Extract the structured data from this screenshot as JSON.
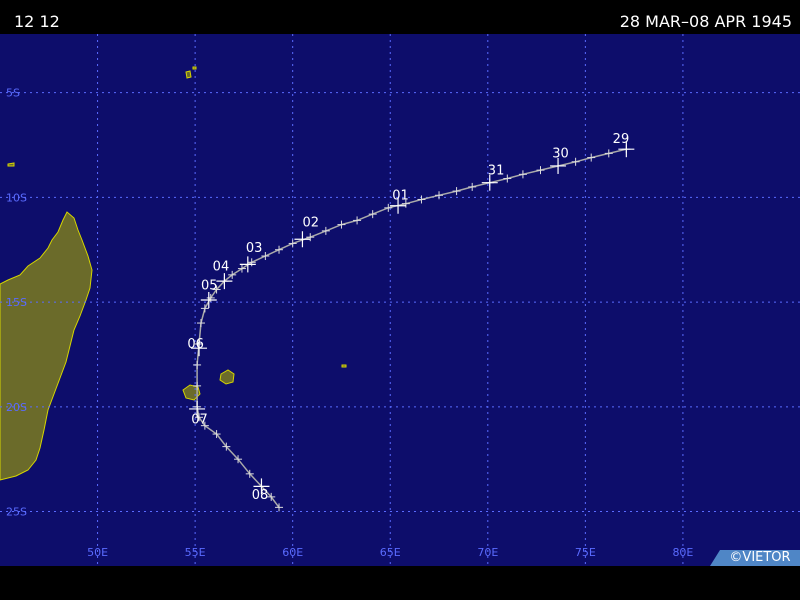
{
  "header": {
    "time_label": "12 12",
    "date_range": "28 MAR–08 APR 1945"
  },
  "credit": "©VIETOR",
  "map": {
    "background": "#0d0d6b",
    "grid_color": "#5a6bff",
    "land_color": "#6b6b2a",
    "coast_color": "#d6d600",
    "track_color": "#aaaaaa",
    "lon_range": [
      45,
      86
    ],
    "lat_range": [
      -27.6,
      -2.2
    ],
    "lon_ticks": [
      50,
      55,
      60,
      65,
      70,
      75,
      80
    ],
    "lon_tick_labels": [
      "50E",
      "55E",
      "60E",
      "65E",
      "70E",
      "75E",
      "80E"
    ],
    "lat_ticks": [
      -5,
      -10,
      -15,
      -20,
      -25
    ],
    "lat_tick_labels": [
      "5S",
      "10S",
      "15S",
      "20S",
      "25S"
    ]
  },
  "track": {
    "points": [
      [
        77.1,
        -7.7
      ],
      [
        76.2,
        -7.9
      ],
      [
        75.3,
        -8.1
      ],
      [
        74.5,
        -8.3
      ],
      [
        73.6,
        -8.5
      ],
      [
        72.7,
        -8.7
      ],
      [
        71.8,
        -8.9
      ],
      [
        71.0,
        -9.1
      ],
      [
        70.1,
        -9.3
      ],
      [
        69.2,
        -9.5
      ],
      [
        68.4,
        -9.7
      ],
      [
        67.5,
        -9.9
      ],
      [
        66.6,
        -10.1
      ],
      [
        65.8,
        -10.3
      ],
      [
        64.9,
        -10.5
      ],
      [
        64.1,
        -10.8
      ],
      [
        63.3,
        -11.1
      ],
      [
        62.5,
        -11.3
      ],
      [
        61.7,
        -11.6
      ],
      [
        60.9,
        -11.9
      ],
      [
        60.0,
        -12.2
      ],
      [
        59.3,
        -12.5
      ],
      [
        58.6,
        -12.8
      ],
      [
        57.9,
        -13.1
      ],
      [
        57.4,
        -13.4
      ],
      [
        56.9,
        -13.7
      ],
      [
        56.5,
        -14.0
      ],
      [
        56.1,
        -14.4
      ],
      [
        55.8,
        -14.8
      ],
      [
        55.5,
        -15.3
      ],
      [
        55.3,
        -16.0
      ],
      [
        55.2,
        -17.0
      ],
      [
        55.1,
        -18.0
      ],
      [
        55.1,
        -19.0
      ],
      [
        55.1,
        -20.0
      ],
      [
        55.2,
        -20.5
      ],
      [
        55.5,
        -20.9
      ],
      [
        56.1,
        -21.3
      ],
      [
        56.6,
        -21.9
      ],
      [
        57.2,
        -22.5
      ],
      [
        57.8,
        -23.2
      ],
      [
        58.4,
        -23.8
      ],
      [
        58.9,
        -24.3
      ],
      [
        59.3,
        -24.8
      ]
    ],
    "daily_labels": [
      {
        "text": "29",
        "lon": 76.4,
        "lat": -7.4
      },
      {
        "text": "30",
        "lon": 73.3,
        "lat": -8.1
      },
      {
        "text": "31",
        "lon": 70.0,
        "lat": -8.9
      },
      {
        "text": "01",
        "lon": 65.1,
        "lat": -10.1
      },
      {
        "text": "02",
        "lon": 60.5,
        "lat": -11.4
      },
      {
        "text": "03",
        "lon": 57.6,
        "lat": -12.6
      },
      {
        "text": "04",
        "lon": 55.9,
        "lat": -13.5
      },
      {
        "text": "05",
        "lon": 55.3,
        "lat": -14.4
      },
      {
        "text": "06",
        "lon": 54.6,
        "lat": -17.2
      },
      {
        "text": "07",
        "lon": 54.8,
        "lat": -20.8
      },
      {
        "text": "08",
        "lon": 57.9,
        "lat": -24.4
      }
    ],
    "daily_markers": [
      [
        77.1,
        -7.7
      ],
      [
        73.6,
        -8.5
      ],
      [
        70.1,
        -9.3
      ],
      [
        65.4,
        -10.4
      ],
      [
        60.5,
        -12.0
      ],
      [
        57.7,
        -13.2
      ],
      [
        56.5,
        -14.0
      ],
      [
        55.7,
        -14.9
      ],
      [
        55.2,
        -17.2
      ],
      [
        55.1,
        -20.1
      ],
      [
        58.4,
        -23.8
      ]
    ]
  }
}
